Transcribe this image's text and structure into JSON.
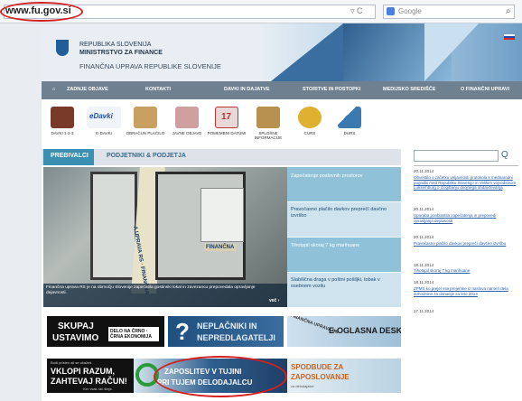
{
  "browser": {
    "url": "www.fu.gov.si",
    "search_placeholder": "Google",
    "url_controls": "▿ C"
  },
  "header": {
    "line1": "REPUBLIKA SLOVENIJA",
    "line2": "MINISTRSTVO ZA FINANCE",
    "line3": "FINANČNA UPRAVA REPUBLIKE SLOVENIJE"
  },
  "nav": {
    "items": [
      "ZADNJE OBJAVE",
      "KONTAKTI",
      "DAVKI IN DAJATVE",
      "STORITVE IN POSTOPKI",
      "MEDIJSKO SREDIŠČE",
      "O FINANČNI UPRAVI"
    ]
  },
  "tiles": [
    {
      "label": "DAVKI 1-2-3",
      "color": "#7a3a2a"
    },
    {
      "label": "E-DAVKI",
      "color": "#f0f4f8"
    },
    {
      "label": "OBRAČUN PLAČILO",
      "color": "#c8a060"
    },
    {
      "label": "JAVNE OBJAVE",
      "color": "#d0a0a0"
    },
    {
      "label": "POMEMBNI DATUMI",
      "color": "#e8d8d8"
    },
    {
      "label": "SPLOŠNE INFORMACIJE",
      "color": "#b89050"
    },
    {
      "label": "CURS",
      "color": "#e0b030"
    },
    {
      "label": "DURS",
      "color": "#3a7ab0"
    }
  ],
  "edavki_logo": "eDavki",
  "tabs": [
    "PREBIVALCI",
    "PODJETNIKI & PODJETJA"
  ],
  "photo": {
    "caption": "Finančna uprava RS je na območju Slovenije zapečatila gostinski lokal in zavezancu prepovedala opravljanje dejavnosti.",
    "more": "več ›",
    "strip_text": "A UPRAVA RS · FINANČNA",
    "plate": "FINANČNA"
  },
  "news": [
    "Zapečatenje poslovnih prostorov",
    "Pravočasno plačilo davkov preprečí davčno izvršbo",
    "Tihotapil skoraj 7 kg marihuane",
    "Slabšična draga v poštni pošiljki, tobak v osebnem vozilu"
  ],
  "feed": [
    {
      "date": "20.11.2014",
      "text": "Obvestilo o začetku veljavnosti protokola k mednarodni pogodbi med Republiko Slovenijo in Velikim vojvodstvom Luksemburg o izogibanju dvojnega obdavčevanja"
    },
    {
      "date": "20.11.2014",
      "text": "Uporaba pooblastila zapečatenja in prepovedi opravljanja dejavnosti"
    },
    {
      "date": "20.11.2014",
      "text": "Pravočasno plačilo davkov preprečí davčno izvršbo"
    },
    {
      "date": "18.11.2014",
      "text": "Tihotapil skoraj 7 kg marihuane"
    },
    {
      "date": "18.11.2014",
      "text": "ZPMS ko prejel vse prejemke iz naslova nameri dela dohodnine za donacije za leto 2013"
    },
    {
      "date": "17.11.2014",
      "text": ""
    }
  ],
  "banners": {
    "b1_line1": "SKUPAJ",
    "b1_line2": "USTAVIMO",
    "b1_badge": "DELO NA ČRNO · ČRNA EKONOMIJA",
    "b2_line1": "NEPLAČNIKI IN",
    "b2_line2": "NEPREDLAGATELJI",
    "b3_text": "E-OGLASNA DESKA",
    "b3_stamp": "FINANČNA UPRAVA RS",
    "b4_small": "Bodi pristen ali se ukažeš",
    "b4_line1": "VKLOPI RAZUM,",
    "b4_line2": "ZAHTEVAJ RAČUN!",
    "b4_note": "Ker vsak rač šteje.",
    "b5_line1": "ZAPOSLITEV V TUJINI",
    "b5_line2": "PRI TUJEM DELODAJALCU",
    "b6_line1": "SPODBUDE ZA",
    "b6_line2": "ZAPOSLOVANJE",
    "b6_note": "za delodajalce"
  }
}
